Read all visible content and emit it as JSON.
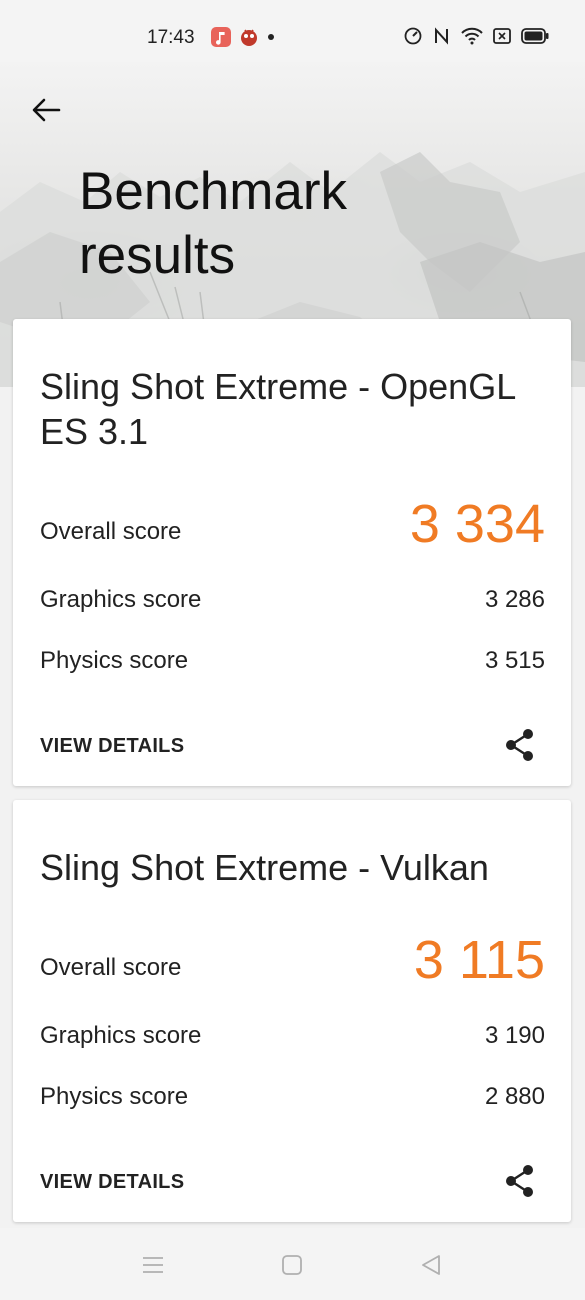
{
  "status_bar": {
    "time": "17:43",
    "left_icons": [
      "music-app-icon",
      "antutu-icon",
      "notification-dot"
    ],
    "right_icons": [
      "data-speed-icon",
      "nfc-icon",
      "wifi-icon",
      "screenshot-icon",
      "battery-icon"
    ]
  },
  "header": {
    "back_icon": "back-arrow-icon",
    "title": "Benchmark results"
  },
  "results": [
    {
      "test_name": "Sling Shot Extreme - OpenGL ES 3.1",
      "overall_label": "Overall score",
      "overall_value": "3 334",
      "graphics_label": "Graphics score",
      "graphics_value": "3 286",
      "physics_label": "Physics score",
      "physics_value": "3 515",
      "details_label": "VIEW DETAILS",
      "share_icon": "share-icon"
    },
    {
      "test_name": "Sling Shot Extreme - Vulkan",
      "overall_label": "Overall score",
      "overall_value": "3 115",
      "graphics_label": "Graphics score",
      "graphics_value": "3 190",
      "physics_label": "Physics score",
      "physics_value": "2 880",
      "details_label": "VIEW DETAILS",
      "share_icon": "share-icon"
    }
  ],
  "nav_bar": {
    "buttons": [
      "menu-icon",
      "home-icon",
      "back-triangle-icon"
    ]
  },
  "colors": {
    "accent": "#f07b24",
    "text": "#222222",
    "card_bg": "#ffffff",
    "page_bg": "#f2f2f2"
  }
}
